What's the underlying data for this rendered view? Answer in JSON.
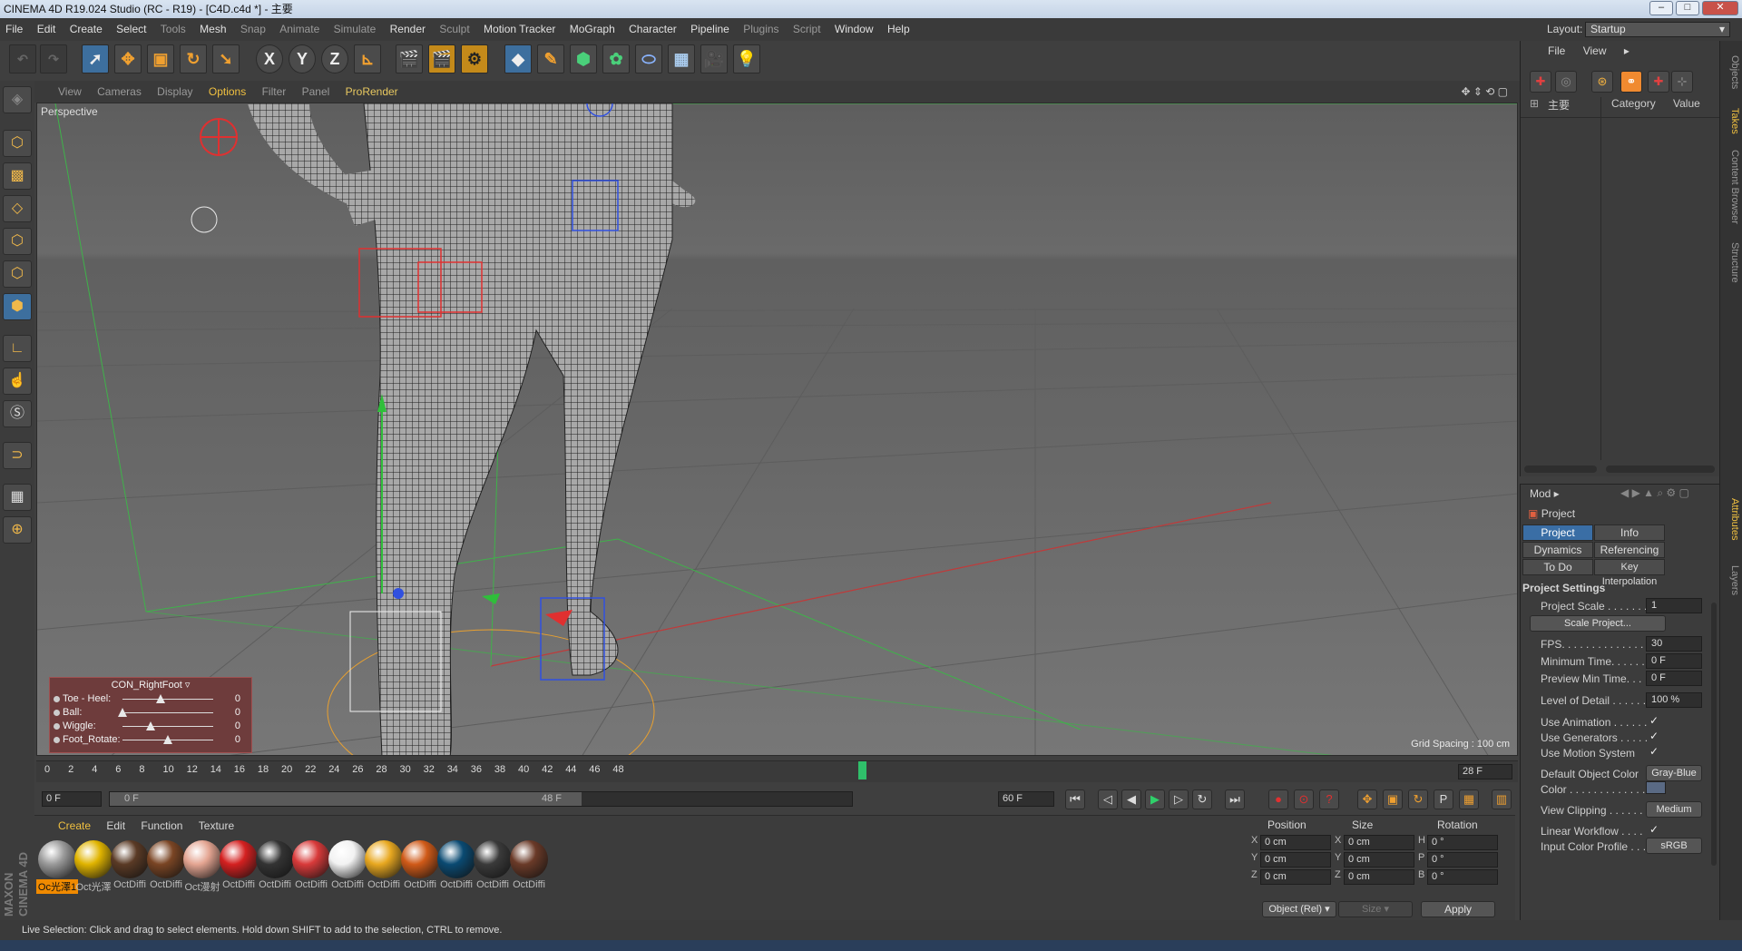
{
  "window": {
    "title": "CINEMA 4D R19.024 Studio (RC - R19) - [C4D.c4d *] - 主要"
  },
  "menubar": {
    "items": [
      "File",
      "Edit",
      "Create",
      "Select",
      "Tools",
      "Mesh",
      "Snap",
      "Animate",
      "Simulate",
      "Render",
      "Sculpt",
      "Motion Tracker",
      "MoGraph",
      "Character",
      "Pipeline",
      "Plugins",
      "Script",
      "Window",
      "Help"
    ]
  },
  "layout": {
    "label": "Layout:",
    "value": "Startup"
  },
  "viewport": {
    "menu": [
      "View",
      "Cameras",
      "Display",
      "Options",
      "Filter",
      "Panel",
      "ProRender"
    ],
    "camera_label": "Perspective",
    "grid_spacing": "Grid Spacing : 100 cm"
  },
  "control_panel": {
    "title": "CON_RightFoot",
    "rows": [
      {
        "label": "Toe - Heel:",
        "value": "0",
        "level": 0.42
      },
      {
        "label": "Ball:",
        "value": "0",
        "level": 0.0
      },
      {
        "label": "Wiggle:",
        "value": "0",
        "level": 0.31
      },
      {
        "label": "Foot_Rotate:",
        "value": "0",
        "level": 0.5
      }
    ]
  },
  "timeline": {
    "ticks": [
      "0",
      "2",
      "4",
      "6",
      "8",
      "10",
      "12",
      "14",
      "16",
      "18",
      "20",
      "22",
      "24",
      "26",
      "28",
      "30",
      "32",
      "34",
      "36",
      "38",
      "40",
      "42",
      "44",
      "46",
      "48"
    ],
    "current_frame_field": "28 F",
    "playhead": "28"
  },
  "playbar": {
    "start_field": "0 F",
    "range_start": "0 F",
    "range_end": "48 F",
    "end_field": "60 F"
  },
  "material_manager": {
    "menu": [
      "Create",
      "Edit",
      "Function",
      "Texture"
    ],
    "materials": [
      {
        "name": "Oc光澤1",
        "color": "#9a9a9a",
        "selected": true
      },
      {
        "name": "Oct光澤",
        "color": "#e0b400",
        "selected": false
      },
      {
        "name": "OctDiffi",
        "color": "#5a3a25",
        "selected": false
      },
      {
        "name": "OctDiffi",
        "color": "#7a4524",
        "selected": false
      },
      {
        "name": "Oct漫射",
        "color": "#e4a592",
        "selected": false
      },
      {
        "name": "OctDiffi",
        "color": "#d42020",
        "selected": false
      },
      {
        "name": "OctDiffi",
        "color": "#333333",
        "selected": false
      },
      {
        "name": "OctDiffi",
        "color": "#d83a3a",
        "selected": false
      },
      {
        "name": "OctDiffi",
        "color": "#f2f2f2",
        "selected": false
      },
      {
        "name": "OctDiffi",
        "color": "#e8a820",
        "selected": false
      },
      {
        "name": "OctDiffi",
        "color": "#d05a18",
        "selected": false
      },
      {
        "name": "OctDiffi",
        "color": "#0a4a72",
        "selected": false
      },
      {
        "name": "OctDiffi",
        "color": "#3a3a3a",
        "selected": false
      },
      {
        "name": "OctDiffi",
        "color": "#6a3a28",
        "selected": false
      }
    ]
  },
  "coordinates": {
    "headers": [
      "Position",
      "Size",
      "Rotation"
    ],
    "rows": [
      {
        "axis": "X",
        "pos": "0 cm",
        "saxis": "X",
        "size": "0 cm",
        "raxis": "H",
        "rot": "0 °"
      },
      {
        "axis": "Y",
        "pos": "0 cm",
        "saxis": "Y",
        "size": "0 cm",
        "raxis": "P",
        "rot": "0 °"
      },
      {
        "axis": "Z",
        "pos": "0 cm",
        "saxis": "Z",
        "size": "0 cm",
        "raxis": "B",
        "rot": "0 °"
      }
    ],
    "mode": "Object (Rel)",
    "size_mode": "Size",
    "apply": "Apply"
  },
  "status": "Live Selection: Click and drag to select elements. Hold down SHIFT to add to the selection, CTRL to remove.",
  "objects_panel": {
    "menu": [
      "File",
      "View"
    ],
    "columns": [
      "主要",
      "Category",
      "Value"
    ]
  },
  "attributes": {
    "mode_label": "Mod",
    "object": "Project",
    "tabs": [
      "Project Settings",
      "Info",
      "Dynamics",
      "Referencing",
      "To Do",
      "Key Interpolation"
    ],
    "section": "Project Settings",
    "rows": [
      {
        "label": "Project Scale . . . . . . .",
        "value": "1"
      },
      {
        "label": "FPS. . . . . . . . . . . . . . . .",
        "value": "30"
      },
      {
        "label": "Minimum Time. . . . . .",
        "value": "0 F"
      },
      {
        "label": "Preview Min Time. . .",
        "value": "0 F"
      },
      {
        "label": "Level of Detail . . . . . .",
        "value": "100 %"
      }
    ],
    "scale_button": "Scale Project...",
    "checks": [
      {
        "label": "Use Animation . . . . . .",
        "mark": "✓"
      },
      {
        "label": "Use Generators . . . . .",
        "mark": "✓"
      },
      {
        "label": "Use Motion System",
        "mark": "✓"
      }
    ],
    "default_color_label": "Default Object Color",
    "default_color_value": "Gray-Blue",
    "color_label": "Color . . . . . . . . . . . . .",
    "view_clipping_label": "View Clipping . . . . . . .",
    "view_clipping_value": "Medium",
    "linear_workflow_label": "Linear Workflow . . . .",
    "linear_workflow_mark": "✓",
    "input_profile_label": "Input Color Profile . . .",
    "input_profile_value": "sRGB"
  },
  "side_tabs": [
    "Objects",
    "Takes",
    "Content Browser",
    "Structure",
    "Attributes",
    "Layers"
  ]
}
